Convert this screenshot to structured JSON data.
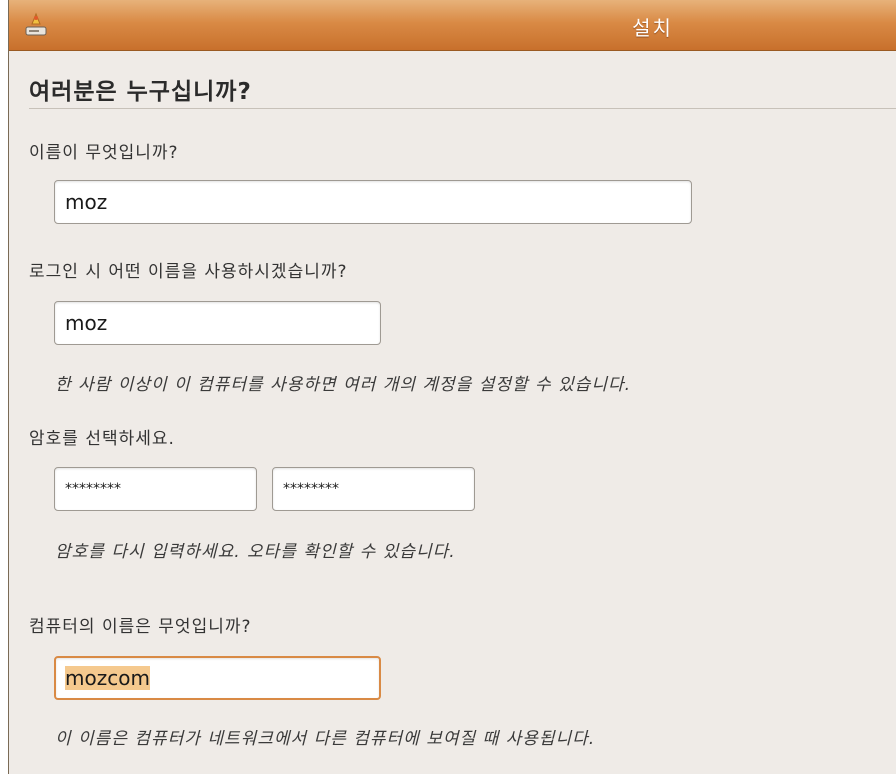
{
  "window": {
    "title": "설치"
  },
  "page": {
    "heading": "여러분은 누구십니까?"
  },
  "name_section": {
    "label": "이름이 무엇입니까?",
    "value": "moz"
  },
  "login_section": {
    "label": "로그인 시 어떤 이름을 사용하시겠습니까?",
    "value": "moz",
    "hint": "한 사람 이상이 이 컴퓨터를 사용하면 여러 개의 계정을 설정할 수 있습니다."
  },
  "password_section": {
    "label": "암호를 선택하세요.",
    "password": "********",
    "confirm": "********",
    "hint": "암호를 다시 입력하세요. 오타를 확인할 수 있습니다."
  },
  "computer_section": {
    "label": "컴퓨터의 이름은 무엇입니까?",
    "value": "mozcom",
    "hint": "이 이름은 컴퓨터가 네트워크에서 다른 컴퓨터에 보여질 때 사용됩니다."
  },
  "icons": {
    "window_icon": "installer-icon"
  },
  "colors": {
    "titlebar": "#d98a45",
    "window_bg": "#efebe7",
    "focus_border": "#d98a45",
    "selection": "#f5c98e"
  }
}
